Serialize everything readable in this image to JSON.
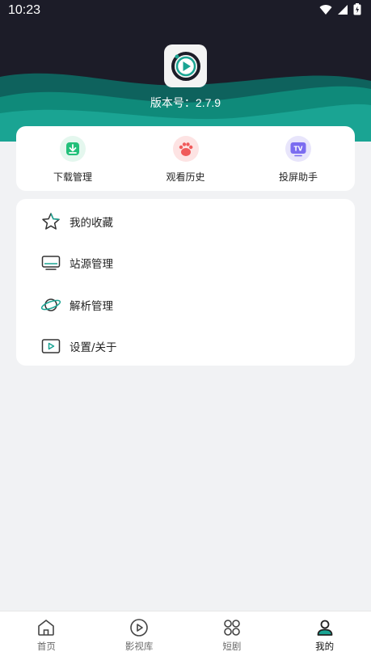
{
  "status_bar": {
    "time": "10:23",
    "icons": [
      "wifi-icon",
      "signal-icon",
      "battery-icon"
    ]
  },
  "header": {
    "logo_icon": "play-logo-icon",
    "version_text": "版本号：2.7.9",
    "colors": {
      "dark": "#1c1c28",
      "teal": "#0f8a7a",
      "teal_light": "#1aa493"
    }
  },
  "quick_actions": [
    {
      "label": "下载管理",
      "icon": "download-icon",
      "color": "#22c07a"
    },
    {
      "label": "观看历史",
      "icon": "paw-icon",
      "color": "#f05a5a"
    },
    {
      "label": "投屏助手",
      "icon": "tv-icon",
      "color": "#7b6cf0"
    }
  ],
  "menu": [
    {
      "label": "我的收藏",
      "icon": "star-icon"
    },
    {
      "label": "站源管理",
      "icon": "monitor-icon"
    },
    {
      "label": "解析管理",
      "icon": "planet-icon"
    },
    {
      "label": "设置/关于",
      "icon": "video-icon"
    }
  ],
  "bottom_nav": [
    {
      "label": "首页",
      "icon": "home-icon",
      "active": false
    },
    {
      "label": "影视库",
      "icon": "play-circle-icon",
      "active": false
    },
    {
      "label": "短剧",
      "icon": "grid-icon",
      "active": false
    },
    {
      "label": "我的",
      "icon": "user-icon",
      "active": true
    }
  ]
}
